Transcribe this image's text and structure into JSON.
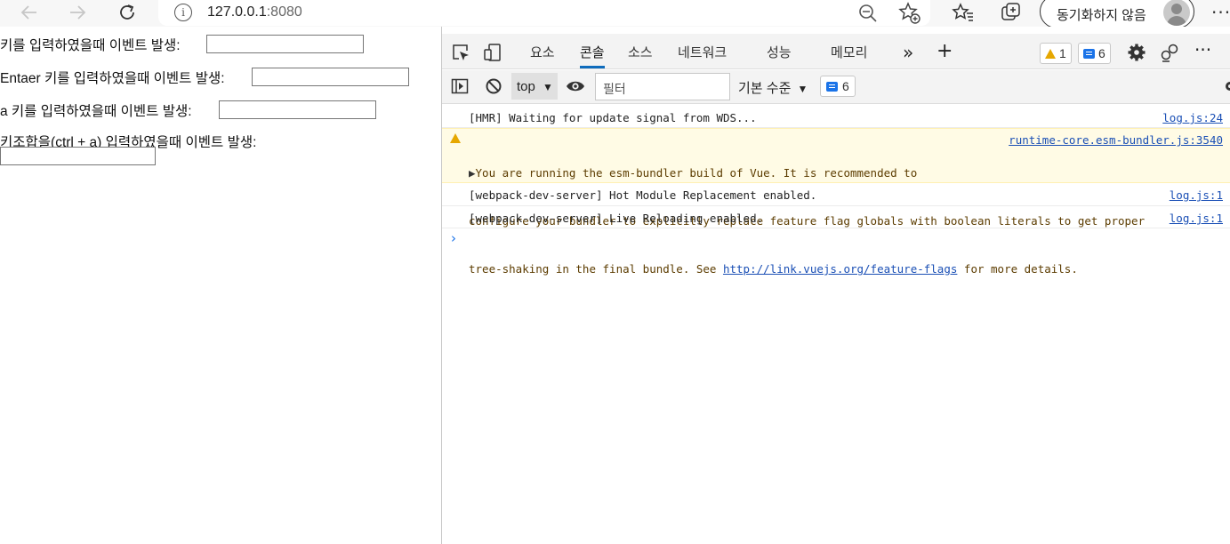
{
  "browser": {
    "url_host": "127.0.0.1",
    "url_port": ":8080",
    "sync_label": "동기화하지 않음"
  },
  "page": {
    "rows": [
      {
        "label": "키를 입력하였을때 이벤트 발생:"
      },
      {
        "label": "Entaer 키를 입력하였을때 이벤트 발생:"
      },
      {
        "label": "a 키를 입력하였을때 이벤트 발생:"
      },
      {
        "label": "키조합을(ctrl + a) 입력하였을때 이벤트 발생:"
      }
    ]
  },
  "devtools": {
    "tabs": [
      "요소",
      "콘솔",
      "소스",
      "네트워크",
      "성능",
      "메모리"
    ],
    "active_tab": "콘솔",
    "warning_count": "1",
    "message_count": "6",
    "toolbar": {
      "context": "top",
      "filter_placeholder": "필터",
      "level": "기본 수준",
      "issues_count": "6"
    },
    "console": {
      "logs": [
        {
          "text": "[HMR] Waiting for update signal from WDS...",
          "source": "log.js:24"
        },
        {
          "text": "[webpack-dev-server] Hot Module Replacement enabled.",
          "source": "log.js:1"
        },
        {
          "text": "[webpack-dev-server] Live Reloading enabled.",
          "source": "log.js:1"
        }
      ],
      "warning": {
        "line1": "You are running the esm-bundler build of Vue. It is recommended to",
        "line2": "configure your bundler to explicitly replace feature flag globals with boolean literals to get proper",
        "line3_pre": "tree-shaking in the final bundle. See ",
        "link": "http://link.vuejs.org/feature-flags",
        "line3_post": " for more details.",
        "source": "runtime-core.esm-bundler.js:3540"
      }
    }
  },
  "colors": {
    "accent": "#0f6cbd",
    "warning": "#e6a700",
    "link": "#1a4fb5",
    "warning_bg": "#fffbe5"
  }
}
